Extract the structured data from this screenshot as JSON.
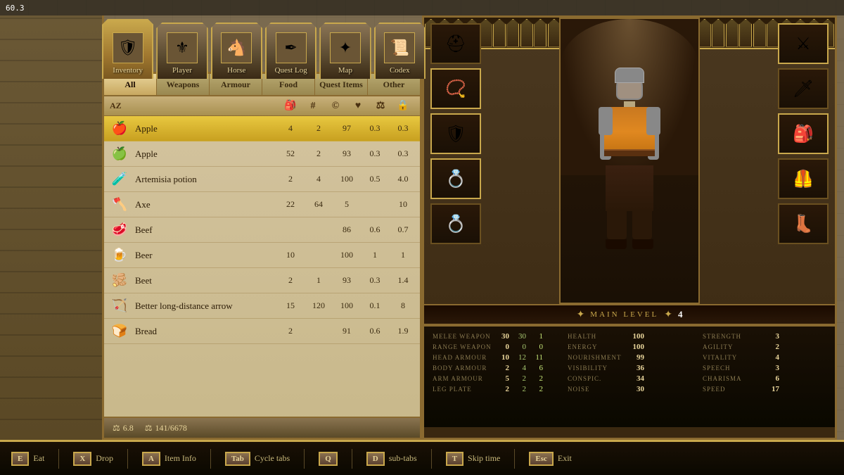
{
  "topbar": {
    "fps": "60.3"
  },
  "nav": {
    "tabs": [
      {
        "id": "inventory",
        "label": "Inventory",
        "icon": "🛡",
        "active": true
      },
      {
        "id": "player",
        "label": "Player",
        "icon": "⚜",
        "active": false
      },
      {
        "id": "horse",
        "label": "Horse",
        "icon": "🐴",
        "active": false
      },
      {
        "id": "questlog",
        "label": "Quest Log",
        "icon": "✒",
        "active": false
      },
      {
        "id": "map",
        "label": "Map",
        "icon": "✦",
        "active": false
      },
      {
        "id": "codex",
        "label": "Codex",
        "icon": "📜",
        "active": false
      }
    ]
  },
  "inventory": {
    "filter_tabs": [
      {
        "id": "all",
        "label": "All",
        "active": true
      },
      {
        "id": "weapons",
        "label": "Weapons"
      },
      {
        "id": "armour",
        "label": "Armour"
      },
      {
        "id": "food",
        "label": "Food"
      },
      {
        "id": "questitems",
        "label": "Quest Items"
      },
      {
        "id": "other",
        "label": "Other"
      }
    ],
    "col_headers": {
      "name": "AZ",
      "bag": "🎒",
      "count": "#",
      "value": "©",
      "heart": "♥",
      "weight": "⚖",
      "lock": "🔒"
    },
    "items": [
      {
        "id": 1,
        "name": "Apple",
        "icon": "🍎",
        "selected": true,
        "qty": 4,
        "slots": 2,
        "value": 97,
        "v1": "0.3",
        "v2": "0.3"
      },
      {
        "id": 2,
        "name": "Apple",
        "icon": "🍏",
        "selected": false,
        "qty": 52,
        "slots": 2,
        "value": 93,
        "v1": "0.3",
        "v2": "0.3"
      },
      {
        "id": 3,
        "name": "Artemisia potion",
        "icon": "🧪",
        "selected": false,
        "qty": 2,
        "slots": 4,
        "value": 100,
        "v1": "0.5",
        "v2": "4.0"
      },
      {
        "id": 4,
        "name": "Axe",
        "icon": "🪓",
        "selected": false,
        "qty": 22,
        "slots": 64,
        "value": 5,
        "v1": "",
        "v2": "10"
      },
      {
        "id": 5,
        "name": "Beef",
        "icon": "🥩",
        "selected": false,
        "qty": "",
        "slots": "",
        "value": 86,
        "v1": "0.6",
        "v2": "0.7"
      },
      {
        "id": 6,
        "name": "Beer",
        "icon": "🍺",
        "selected": false,
        "qty": 10,
        "slots": "",
        "value": 100,
        "v1": "1",
        "v2": "1"
      },
      {
        "id": 7,
        "name": "Beet",
        "icon": "🫚",
        "selected": false,
        "qty": 2,
        "slots": 1,
        "value": 93,
        "v1": "0.3",
        "v2": "1.4"
      },
      {
        "id": 8,
        "name": "Better long-distance arrow",
        "icon": "🏹",
        "selected": false,
        "qty": 15,
        "slots": 120,
        "value": 100,
        "v1": "0.1",
        "v2": "8"
      },
      {
        "id": 9,
        "name": "Bread",
        "icon": "🍞",
        "selected": false,
        "qty": 2,
        "slots": "",
        "value": 91,
        "v1": "0.6",
        "v2": "1.9"
      }
    ],
    "bottom": {
      "weight_icon": "⚖",
      "weight_val": "6.8",
      "gold_icon": "⚖",
      "gold_val": "141/6678"
    }
  },
  "character": {
    "main_level_label": "MAIN LEVEL",
    "main_level_value": "4",
    "equip_slots_left": [
      {
        "id": "helmet",
        "icon": "⛑",
        "filled": false
      },
      {
        "id": "amulet",
        "icon": "📿",
        "filled": true
      },
      {
        "id": "chest",
        "icon": "🛡",
        "filled": true
      },
      {
        "id": "ring1",
        "icon": "💍",
        "filled": true
      },
      {
        "id": "ring2",
        "icon": "💍",
        "filled": false
      }
    ],
    "equip_slots_right": [
      {
        "id": "weapon1",
        "icon": "⚔",
        "filled": true
      },
      {
        "id": "weapon2",
        "icon": "🗡",
        "filled": false
      },
      {
        "id": "belt",
        "icon": "🎒",
        "filled": true
      },
      {
        "id": "legs",
        "icon": "🦺",
        "filled": false
      },
      {
        "id": "boots",
        "icon": "👢",
        "filled": false
      }
    ],
    "stats": [
      {
        "label": "MELEE WEAPON",
        "v1": "30",
        "v2": "30",
        "v3": "1"
      },
      {
        "label": "RANGE WEAPON",
        "v1": "0",
        "v2": "0",
        "v3": "0"
      },
      {
        "label": "HEAD ARMOUR",
        "v1": "10",
        "v2": "12",
        "v3": "11"
      },
      {
        "label": "BODY ARMOUR",
        "v1": "2",
        "v2": "4",
        "v3": "6"
      },
      {
        "label": "ARM ARMOUR",
        "v1": "5",
        "v2": "2",
        "v3": "2"
      },
      {
        "label": "LEG PLATE",
        "v1": "2",
        "v2": "2",
        "v3": "2"
      }
    ],
    "vital_stats": [
      {
        "label": "HEALTH",
        "val": "100"
      },
      {
        "label": "ENERGY",
        "val": "100"
      },
      {
        "label": "NOURISHMENT",
        "val": "99"
      },
      {
        "label": "VISIBILITY",
        "val": "36"
      },
      {
        "label": "CONSPIC.",
        "val": "34"
      },
      {
        "label": "NOISE",
        "val": "30"
      }
    ],
    "attributes": [
      {
        "label": "STRENGTH",
        "val": "3"
      },
      {
        "label": "AGILITY",
        "val": "2"
      },
      {
        "label": "VITALITY",
        "val": "4"
      },
      {
        "label": "SPEECH",
        "val": "3"
      },
      {
        "label": "CHARISMA",
        "val": "6"
      },
      {
        "label": "SPEED",
        "val": "17"
      }
    ]
  },
  "actionbar": {
    "actions": [
      {
        "key": "E",
        "label": "Eat"
      },
      {
        "key": "X",
        "label": "Drop"
      },
      {
        "key": "A",
        "label": "Item Info"
      },
      {
        "key": "Tab",
        "label": "Cycle tabs"
      },
      {
        "key": "Q",
        "label": ""
      },
      {
        "key": "D",
        "label": "sub-tabs"
      },
      {
        "key": "T",
        "label": "Skip time"
      },
      {
        "key": "Esc",
        "label": "Exit"
      }
    ]
  }
}
